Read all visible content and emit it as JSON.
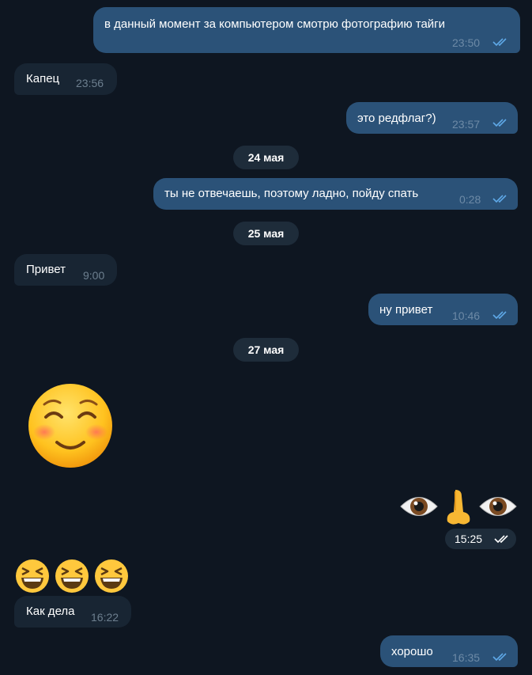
{
  "messages": [
    {
      "text": "в данный момент за компьютером смотрю фотографию тайги",
      "time": "23:50"
    },
    {
      "text": "Капец",
      "time": "23:56"
    },
    {
      "text": "это редфлаг?)",
      "time": "23:57"
    },
    {
      "text": "ты не отвечаешь, поэтому ладно, пойду спать",
      "time": "0:28"
    },
    {
      "text": "Привет",
      "time": "9:00"
    },
    {
      "text": "ну привет",
      "time": "10:46"
    },
    {
      "text": "☺️",
      "time": ""
    },
    {
      "text": "👁👃👁",
      "time": "15:25"
    },
    {
      "text": "😆😆😆",
      "time": ""
    },
    {
      "text": "Как дела",
      "time": "16:22"
    },
    {
      "text": "хорошо",
      "time": "16:35"
    }
  ],
  "dates": [
    "24 мая",
    "25 мая",
    "27 мая"
  ],
  "colors": {
    "background": "#0e1621",
    "outgoing_bubble": "#2b5278",
    "incoming_bubble": "#182533",
    "read_ticks": "#5fa9e8"
  }
}
